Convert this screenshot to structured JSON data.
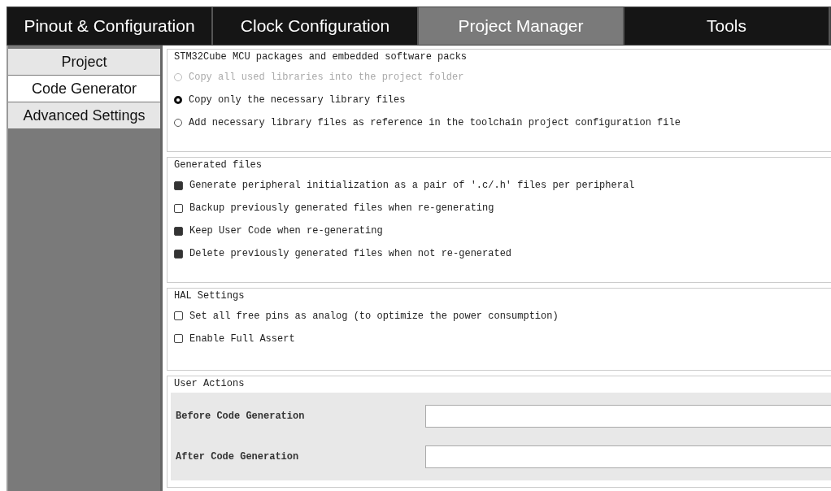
{
  "tabs": [
    {
      "label": "Pinout & Configuration",
      "selected": false
    },
    {
      "label": "Clock Configuration",
      "selected": false
    },
    {
      "label": "Project Manager",
      "selected": true
    },
    {
      "label": "Tools",
      "selected": false
    }
  ],
  "sidebar": {
    "items": [
      {
        "label": "Project",
        "selected": false
      },
      {
        "label": "Code Generator",
        "selected": true
      },
      {
        "label": "Advanced Settings",
        "selected": false
      }
    ]
  },
  "sections": [
    {
      "title": "STM32Cube MCU packages and embedded software packs",
      "kind": "radios",
      "options": [
        {
          "label": "Copy all used libraries into the project folder",
          "selected": false,
          "disabled": true
        },
        {
          "label": "Copy only the necessary library files",
          "selected": true,
          "disabled": false
        },
        {
          "label": "Add necessary library files as reference in the toolchain project configuration file",
          "selected": false,
          "disabled": false
        }
      ]
    },
    {
      "title": "Generated files",
      "kind": "checks",
      "options": [
        {
          "label": "Generate peripheral initialization as a pair of '.c/.h' files per peripheral",
          "checked": true
        },
        {
          "label": "Backup previously generated files when re-generating",
          "checked": false
        },
        {
          "label": "Keep User Code when re-generating",
          "checked": true
        },
        {
          "label": "Delete previously generated files when not re-generated",
          "checked": true
        }
      ]
    },
    {
      "title": "HAL Settings",
      "kind": "checks",
      "options": [
        {
          "label": "Set all free pins as analog (to optimize the power consumption)",
          "checked": false
        },
        {
          "label": "Enable Full Assert",
          "checked": false
        }
      ]
    },
    {
      "title": "User Actions",
      "kind": "fields",
      "fields": [
        {
          "label": "Before Code Generation"
        },
        {
          "label": "After Code Generation"
        }
      ]
    }
  ]
}
